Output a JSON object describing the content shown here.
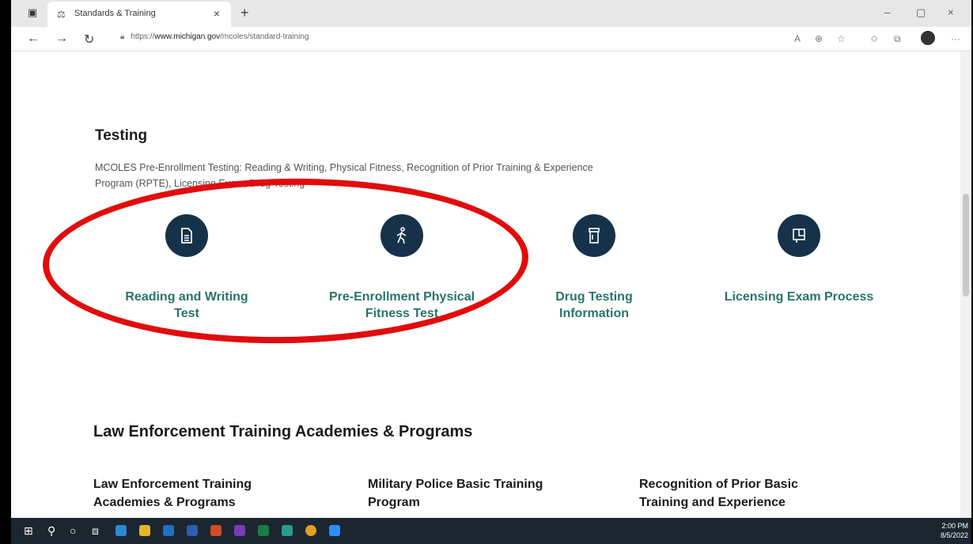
{
  "browser": {
    "tab_title": "Standards & Training",
    "tab_close": "×",
    "new_tab": "+",
    "url_prefix": "https://",
    "url_domain": "www.michigan.gov",
    "url_path": "/mcoles/standard-training",
    "window_controls": [
      "–",
      "▢",
      "×"
    ],
    "toolbar_icons": [
      "read-aloud-icon",
      "zoom-icon",
      "favorites-add-icon",
      "favorites-icon",
      "collections-icon",
      "profile-avatar",
      "more-icon"
    ]
  },
  "page": {
    "testing_heading": "Testing",
    "testing_description": "MCOLES Pre-Enrollment Testing: Reading & Writing, Physical Fitness, Recognition of Prior Training & Experience Program (RPTE), Licensing Exam, Drug Testing",
    "cards": [
      {
        "label_line1": "Reading and Writing",
        "label_line2": "Test",
        "icon": "document-icon"
      },
      {
        "label_line1": "Pre-Enrollment Physical",
        "label_line2": "Fitness Test",
        "icon": "walking-person-icon"
      },
      {
        "label_line1": "Drug Testing",
        "label_line2": "Information",
        "icon": "pill-bottle-icon"
      },
      {
        "label_line1": "Licensing Exam Process",
        "label_line2": "",
        "icon": "license-icon"
      }
    ],
    "law_heading": "Law Enforcement Training Academies & Programs",
    "programs": [
      {
        "line1": "Law Enforcement Training",
        "line2": "Academies & Programs"
      },
      {
        "line1": "Military Police Basic Training",
        "line2": "Program"
      },
      {
        "line1": "Recognition of Prior Basic",
        "line2": "Training and Experience"
      }
    ]
  },
  "taskbar": {
    "time": "2:00 PM",
    "date": "8/5/2022"
  },
  "colors": {
    "accent_link": "#287468",
    "icon_circle": "#16324a",
    "annotation_red": "#e10c0c"
  }
}
